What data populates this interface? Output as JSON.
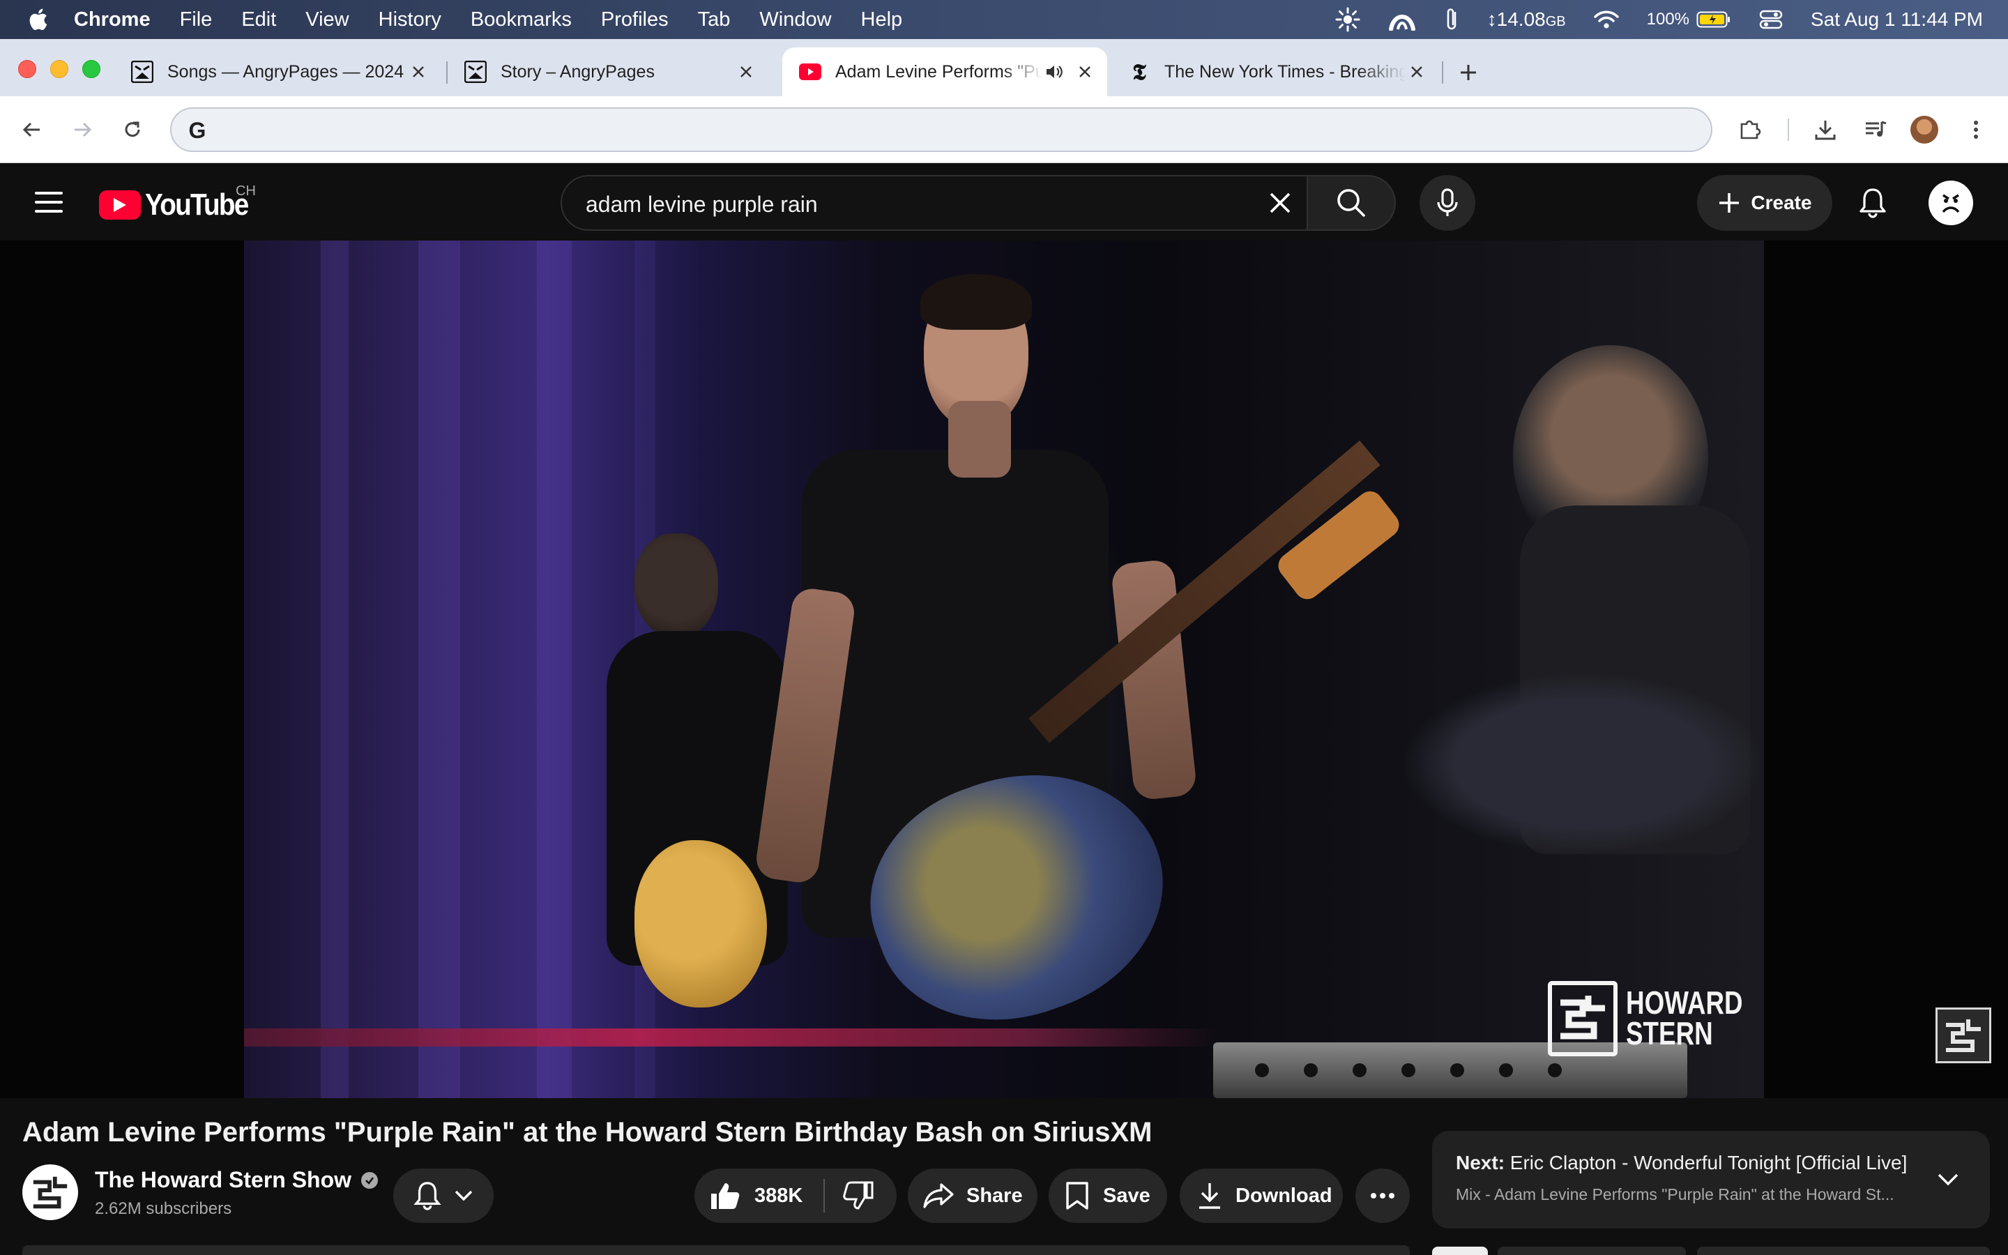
{
  "menubar": {
    "app": "Chrome",
    "items": [
      "File",
      "Edit",
      "View",
      "History",
      "Bookmarks",
      "Profiles",
      "Tab",
      "Window",
      "Help"
    ],
    "memory": "↕14.08",
    "memory_unit": "GB",
    "battery": "100%",
    "clock": "Sat Aug 1  11:44 PM"
  },
  "tabs": [
    {
      "label": "Songs — AngryPages — 2024",
      "active": false
    },
    {
      "label": "Story – AngryPages",
      "active": false
    },
    {
      "label": "Adam Levine Performs \"Purple Rain\"",
      "active": true
    },
    {
      "label": "The New York Times - Breaking News",
      "active": false
    }
  ],
  "omnibox": {
    "value": ""
  },
  "youtube": {
    "logo_text": "YouTube",
    "country": "CH",
    "search_query": "adam levine purple rain",
    "create_label": "Create"
  },
  "video": {
    "watermark_line1": "HOWARD",
    "watermark_line2": "STERN",
    "title": "Adam Levine Performs \"Purple Rain\" at the Howard Stern Birthday Bash on SiriusXM",
    "channel": "The Howard Stern Show",
    "subscribers": "2.62M subscribers",
    "likes": "388K",
    "share_label": "Share",
    "save_label": "Save",
    "download_label": "Download"
  },
  "next": {
    "prefix": "Next:",
    "title": "Eric Clapton - Wonderful Tonight [Official Live]",
    "subtitle": "Mix - Adam Levine Performs \"Purple Rain\" at the Howard St..."
  },
  "colors": {
    "yt_red": "#ff0033",
    "bg": "#0f0f0f",
    "pill": "#272727"
  }
}
